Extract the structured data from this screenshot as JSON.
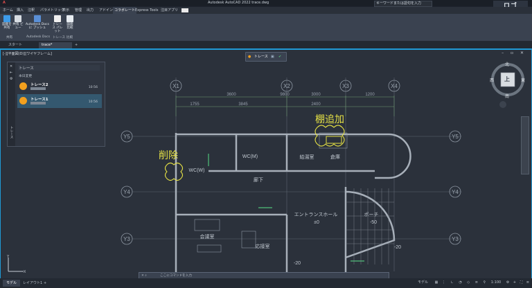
{
  "app": {
    "title": "Autodesk AutoCAD 2022    trace.dwg",
    "search_placeholder": "キーワードまたは語句を入力",
    "brand": "ロゴ"
  },
  "ribbon_tabs": [
    "ホーム",
    "挿入",
    "注釈",
    "パラメトリック",
    "表示",
    "管理",
    "出力",
    "アドイン",
    "コラボレート",
    "Express Tools",
    "注目アプリ"
  ],
  "active_tab_index": 8,
  "ribbon": {
    "buttons": [
      {
        "label": "図面を\n共有",
        "color": "#3d9be9"
      },
      {
        "label": "共有\nビュー",
        "color": "#d8dde3"
      },
      {
        "label": "Autodesk Docs に\nプッシュ",
        "color": "#5a8fd6"
      },
      {
        "label": "トレース\nパレット",
        "color": "#f0f0f0"
      },
      {
        "label": "図面\n比較",
        "color": "#e8edf2"
      }
    ],
    "panel_labels": [
      "共有",
      "Autodesk Docs",
      "トレース",
      "比較"
    ]
  },
  "doc_tabs": [
    "スタート",
    "trace*"
  ],
  "viewport": {
    "label": "[-][平面図(D)][ワイヤフレーム]"
  },
  "trace_toolbar": {
    "label": "トレース"
  },
  "palette": {
    "title": "トレース",
    "section": "本日変更",
    "items": [
      {
        "name": "トレース2",
        "time": "10:56"
      },
      {
        "name": "トレース1",
        "time": "10:56"
      }
    ],
    "side_label": "トレース"
  },
  "viewcube": {
    "north": "北",
    "south": "南",
    "east": "東",
    "west": "西",
    "face": "上"
  },
  "annotations": [
    "棚追加",
    "削除"
  ],
  "grid_labels": [
    "X1",
    "X2",
    "X3",
    "X4",
    "Y5",
    "Y4",
    "Y3"
  ],
  "dimensions": [
    "9800",
    "3600",
    "3000",
    "1200",
    "1755",
    "3845",
    "2400",
    "1200",
    "1200",
    "1200"
  ],
  "room_labels": [
    "WC(M)",
    "WC(W)",
    "給湯室",
    "廊下",
    "エントランスホール",
    "ポーチ",
    "会議室",
    "応接室",
    "倉庫"
  ],
  "levels": [
    "±0",
    "-50",
    "-20",
    "-20"
  ],
  "command_placeholder": "ここにコマンドを入力",
  "layout_tabs": [
    "モデル",
    "レイアウト1"
  ],
  "status": {
    "mode": "モデル",
    "scale": "1:100"
  }
}
